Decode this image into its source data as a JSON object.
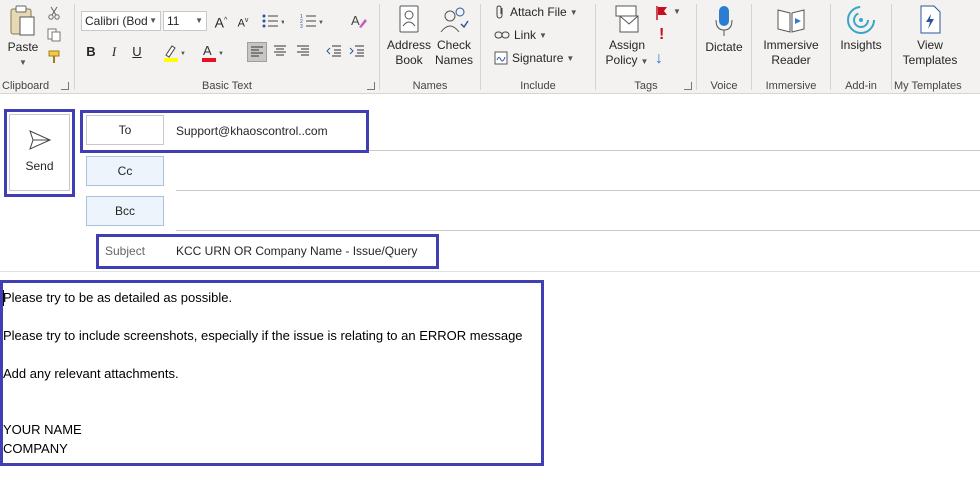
{
  "ribbon": {
    "clipboard": {
      "paste": "Paste",
      "label": "Clipboard"
    },
    "basic_text": {
      "font_name": "Calibri (Bod",
      "font_size": "11",
      "label": "Basic Text",
      "bold": "B",
      "italic": "I",
      "underline": "U"
    },
    "names": {
      "address_book": "Address Book",
      "check_names": "Check Names",
      "label": "Names"
    },
    "include": {
      "attach_file": "Attach File",
      "link": "Link",
      "signature": "Signature",
      "label": "Include"
    },
    "tags": {
      "assign_policy": "Assign Policy",
      "label": "Tags"
    },
    "voice": {
      "dictate": "Dictate",
      "label": "Voice"
    },
    "immersive": {
      "reader": "Immersive Reader",
      "label": "Immersive"
    },
    "addin": {
      "insights": "Insights",
      "label": "Add-in"
    },
    "templates": {
      "view": "View Templates",
      "label": "My Templates"
    }
  },
  "compose": {
    "send": "Send",
    "to_label": "To",
    "to_value": "Support@khaoscontrol..com",
    "cc_label": "Cc",
    "bcc_label": "Bcc",
    "subject_label": "Subject",
    "subject_value": "KCC URN OR Company Name - Issue/Query"
  },
  "body": {
    "line1": "Please try to be as detailed as possible.",
    "line2": "Please try to include screenshots, especially if the issue is relating to an ERROR message",
    "line3": "Add any relevant attachments.",
    "name": "YOUR NAME",
    "company": "COMPANY"
  },
  "colors": {
    "highlight_border": "#3f3fb3",
    "ribbon_bg": "#f3f2f1",
    "font_color_bar": "#e81123",
    "highlight_bar": "#ffff00",
    "accent_blue": "#2b579a"
  }
}
